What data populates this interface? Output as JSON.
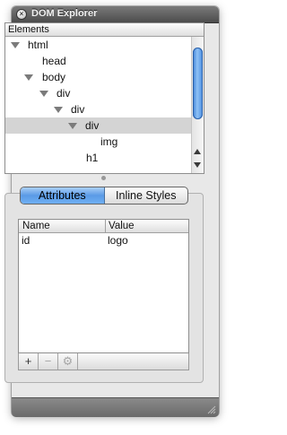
{
  "window": {
    "title": "DOM Explorer"
  },
  "elements_pane": {
    "header": "Elements",
    "nodes": [
      {
        "label": "html",
        "expanded": true,
        "selected": false
      },
      {
        "label": "head",
        "expanded": false,
        "selected": false
      },
      {
        "label": "body",
        "expanded": true,
        "selected": false
      },
      {
        "label": "div",
        "expanded": true,
        "selected": false
      },
      {
        "label": "div",
        "expanded": true,
        "selected": false
      },
      {
        "label": "div",
        "expanded": true,
        "selected": true
      },
      {
        "label": "img",
        "expanded": false,
        "selected": false
      },
      {
        "label": "h1",
        "expanded": false,
        "selected": false
      }
    ]
  },
  "tabs": [
    {
      "label": "Attributes",
      "active": true
    },
    {
      "label": "Inline Styles",
      "active": false
    }
  ],
  "properties": {
    "columns": [
      "Name",
      "Value"
    ],
    "rows": [
      {
        "name": "id",
        "value": "logo"
      }
    ]
  },
  "toolbar": {
    "add_label": "+",
    "remove_label": "−",
    "action_label": "⚙"
  },
  "colors": {
    "selection": "#d4d4d4",
    "accent": "#5a9ae6",
    "titlebar": "#5a5a5a"
  }
}
